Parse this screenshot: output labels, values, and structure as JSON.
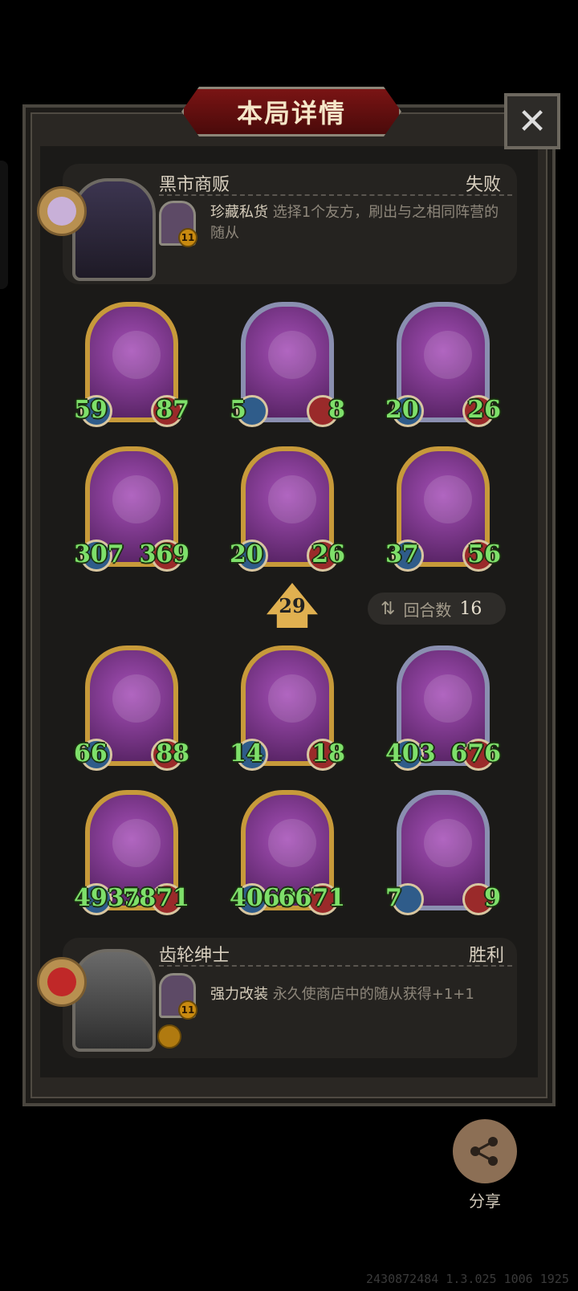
{
  "title": "本局详情",
  "close_label": "✕",
  "opponent": {
    "name": "黑市商贩",
    "result": "失败",
    "skill_name": "珍藏私货",
    "skill_desc": "选择1个友方，刷出与之相同阵营的随从",
    "skill_level": "11"
  },
  "player": {
    "name": "齿轮绅士",
    "result": "胜利",
    "skill_name": "强力改装",
    "skill_desc": "永久使商店中的随从获得+1+1",
    "skill_level": "11"
  },
  "opponent_board": [
    {
      "atk": "59",
      "hp": "87",
      "style": "gold"
    },
    {
      "atk": "5",
      "hp": "8",
      "style": "silver"
    },
    {
      "atk": "20",
      "hp": "26",
      "style": "silver"
    },
    {
      "atk": "307",
      "hp": "369",
      "style": "gold"
    },
    {
      "atk": "20",
      "hp": "26",
      "style": "gold"
    },
    {
      "atk": "37",
      "hp": "56",
      "style": "gold"
    }
  ],
  "player_board": [
    {
      "atk": "66",
      "hp": "88",
      "style": "gold"
    },
    {
      "atk": "14",
      "hp": "18",
      "style": "gold"
    },
    {
      "atk": "403",
      "hp": "676",
      "style": "silver"
    },
    {
      "atk": "4935",
      "hp": "7871",
      "style": "gold"
    },
    {
      "atk": "4069",
      "hp": "6671",
      "style": "gold"
    },
    {
      "atk": "7",
      "hp": "9",
      "style": "silver"
    }
  ],
  "tier": "29",
  "rounds_label": "回合数",
  "rounds_value": "16",
  "share_label": "分享",
  "footer_id": "2430872484 1.3.025 1006 1925",
  "colors": {
    "banner_red": "#7a1414",
    "stat_green": "#7ee06a",
    "gold_frame": "#c79a3a",
    "silver_frame": "#8a8fb0"
  }
}
